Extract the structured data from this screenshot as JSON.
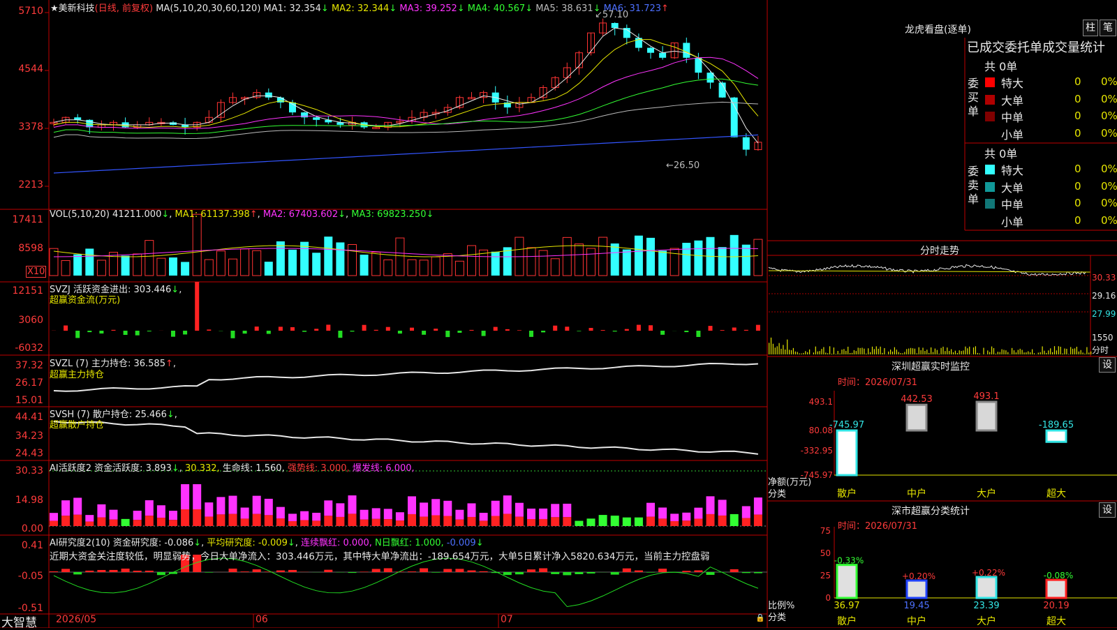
{
  "stock": {
    "title": "★美新科技",
    "mode": "(日线, 前复权)",
    "ma_prefix": "MA(5,10,20,30,60,120)",
    "ma": [
      {
        "label": "MA1:",
        "value": "32.354",
        "arrow": "↓",
        "color": "#e8e8e8"
      },
      {
        "label": "MA2:",
        "value": "32.344",
        "arrow": "↓",
        "color": "#e6e600"
      },
      {
        "label": "MA3:",
        "value": "39.252",
        "arrow": "↓",
        "color": "#ff33ff"
      },
      {
        "label": "MA4:",
        "value": "40.567",
        "arrow": "↓",
        "color": "#33ff33"
      },
      {
        "label": "MA5:",
        "value": "38.631",
        "arrow": "↓",
        "color": "#bbbbbb"
      },
      {
        "label": "MA6:",
        "value": "31.723",
        "arrow": "↑",
        "color": "#4d70ff"
      }
    ],
    "high_label": "57.10",
    "low_label": "26.50",
    "y_ticks": [
      "5710",
      "4544",
      "3378",
      "2213"
    ]
  },
  "vol": {
    "header": "VOL(5,10,20)",
    "value": "41211.000",
    "ma1": "MA1: 61137.398",
    "ma2": "MA2: 67403.602",
    "ma3": "MA3: 69823.250",
    "y_ticks": [
      "17411",
      "8598"
    ],
    "unit": "X10"
  },
  "svzj": {
    "header": "SVZJ  活跃资金进出: 303.446",
    "sub": "超赢资金流(万元)",
    "y_ticks": [
      "12151",
      "3060",
      "-6032"
    ]
  },
  "svzl": {
    "header": "SVZL (7) 主力持仓: 36.585",
    "sub": "超赢主力持仓",
    "y_ticks": [
      "37.32",
      "26.17",
      "15.01"
    ]
  },
  "svsh": {
    "header": "SVSH (7) 散户持仓: 25.466",
    "sub": "超赢散户持仓",
    "y_ticks": [
      "44.41",
      "34.23",
      "24.43"
    ]
  },
  "ai1": {
    "header": "AI活跃度2 资金活跃度: 3.893",
    "v1": "30.332,",
    "v2": "生命线: 1.560,",
    "v3": "强势线: 3.000,",
    "v4": "爆发线: 6.000,",
    "y_ticks": [
      "30.33",
      "14.98",
      "0.00"
    ]
  },
  "ai2": {
    "header": "AI研究度2(10) 资金研究度: -0.086",
    "v1": "平均研究度: -0.009",
    "v2": "连续飘红: 0.000,",
    "v3": "N日飘红: 1.000,",
    "v4": "-0.009",
    "comment": "近期大资金关注度较低，明显弱势，今日大单净流入：303.446万元，其中特大单净流出：-189.654万元，大单5日累计净入5820.634万元，当前主力控盘弱",
    "y_ticks": [
      "0.41",
      "-0.05",
      "-0.51"
    ]
  },
  "footer": {
    "brand": "大智慧",
    "dates": [
      "2026/05",
      "06",
      "07"
    ]
  },
  "right": {
    "title": "龙虎看盘(逐单)",
    "btn1": "柱",
    "btn2": "笔",
    "stat_title": "已成交委托单成交量统计",
    "buy_label": "委买单",
    "sell_label": "委卖单",
    "buy_total": "共 0单",
    "sell_total": "共 0单",
    "buy_rows": [
      {
        "name": "特大",
        "v": "0",
        "p": "0%",
        "color": "#ff0000"
      },
      {
        "name": "大单",
        "v": "0",
        "p": "0%",
        "color": "#b00000"
      },
      {
        "name": "中单",
        "v": "0",
        "p": "0%",
        "color": "#800000"
      },
      {
        "name": "小单",
        "v": "0",
        "p": "0%",
        "color": "#000000"
      }
    ],
    "sell_rows": [
      {
        "name": "特大",
        "v": "0",
        "p": "0%",
        "color": "#33ffff"
      },
      {
        "name": "大单",
        "v": "0",
        "p": "0%",
        "color": "#119999"
      },
      {
        "name": "中单",
        "v": "0",
        "p": "0%",
        "color": "#117777"
      },
      {
        "name": "小单",
        "v": "0",
        "p": "0%",
        "color": "#000000"
      }
    ],
    "intraday_title": "分时走势",
    "intraday_ticks": [
      "30.33",
      "29.16",
      "27.99"
    ],
    "intraday_vol": "1550",
    "intraday_vol_unit": "分时",
    "monitor_title": "深圳超赢实时监控",
    "monitor_btn": "设",
    "monitor_time": "时间：2026/07/31",
    "monitor_ticks": [
      "493.1",
      "80.08",
      "-332.95",
      "-745.97"
    ],
    "monitor_axis": "净额(万元)",
    "monitor_cat_label": "分类",
    "stats_title": "深市超赢分类统计",
    "stats_btn": "设",
    "stats_time": "时间：2026/07/31",
    "stats_ticks": [
      "75",
      "50",
      "25",
      "0"
    ],
    "stats_axis": "比例%",
    "stats_cat_label": "分类"
  },
  "chart_data": [
    {
      "type": "bar",
      "title": "深圳超赢实时监控",
      "categories": [
        "散户",
        "中户",
        "大户",
        "超大"
      ],
      "values": [
        -745.97,
        442.53,
        493.1,
        -189.65
      ],
      "ylabel": "净额(万元)",
      "ylim": [
        -745.97,
        493.1
      ]
    },
    {
      "type": "bar",
      "title": "深市超赢分类统计",
      "categories": [
        "散户",
        "中户",
        "大户",
        "超大"
      ],
      "values": [
        36.97,
        19.45,
        23.39,
        20.19
      ],
      "changes": [
        "-0.33%",
        "+0.20%",
        "+0.22%",
        "-0.08%"
      ],
      "ylabel": "比例%",
      "ylim": [
        0,
        75
      ]
    }
  ]
}
